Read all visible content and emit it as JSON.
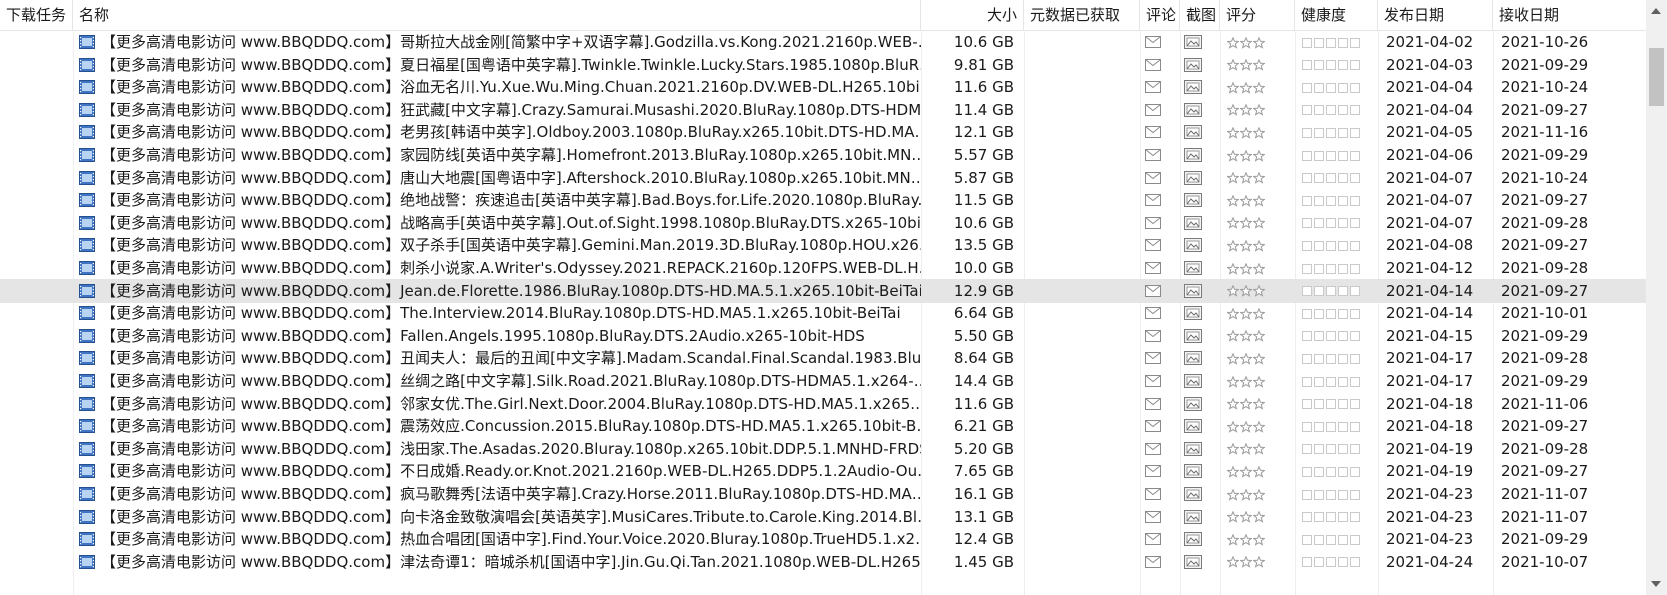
{
  "columns": {
    "task": "下载任务",
    "name": "名称",
    "size": "大小",
    "metadata": "元数据已获取",
    "comments": "评论",
    "screenshot": "截图",
    "rating": "评分",
    "health": "健康度",
    "published": "发布日期",
    "received": "接收日期"
  },
  "icons": {
    "file": "video-file-icon",
    "comment": "envelope-icon",
    "screenshot": "image-icon",
    "rating": "star-icon",
    "health": "health-square-icon"
  },
  "colors": {
    "selected_row": "#e5e5e5",
    "grid_line": "#eeeeee",
    "star": "#9a9a9a"
  },
  "selected_index": 11,
  "rows": [
    {
      "name": "【更多高清电影访问 www.BBQDDQ.com】哥斯拉大战金刚[简繁中字+双语字幕].Godzilla.vs.Kong.2021.2160p.WEB-…",
      "size": "10.6 GB",
      "published": "2021-04-02",
      "received": "2021-10-26"
    },
    {
      "name": "【更多高清电影访问 www.BBQDDQ.com】夏日福星[国粤语中英字幕].Twinkle.Twinkle.Lucky.Stars.1985.1080p.BluR…",
      "size": "9.81 GB",
      "published": "2021-04-03",
      "received": "2021-09-29"
    },
    {
      "name": "【更多高清电影访问 www.BBQDDQ.com】浴血无名川.Yu.Xue.Wu.Ming.Chuan.2021.2160p.DV.WEB-DL.H265.10bi…",
      "size": "11.6 GB",
      "published": "2021-04-04",
      "received": "2021-10-24"
    },
    {
      "name": "【更多高清电影访问 www.BBQDDQ.com】狂武藏[中文字幕].Crazy.Samurai.Musashi.2020.BluRay.1080p.DTS-HDM…",
      "size": "11.4 GB",
      "published": "2021-04-04",
      "received": "2021-09-27"
    },
    {
      "name": "【更多高清电影访问 www.BBQDDQ.com】老男孩[韩语中英字].Oldboy.2003.1080p.BluRay.x265.10bit.DTS-HD.MA…",
      "size": "12.1 GB",
      "published": "2021-04-05",
      "received": "2021-11-16"
    },
    {
      "name": "【更多高清电影访问 www.BBQDDQ.com】家园防线[英语中英字幕].Homefront.2013.BluRay.1080p.x265.10bit.MN…",
      "size": "5.57 GB",
      "published": "2021-04-06",
      "received": "2021-09-29"
    },
    {
      "name": "【更多高清电影访问 www.BBQDDQ.com】唐山大地震[国粤语中字].Aftershock.2010.BluRay.1080p.x265.10bit.MN…",
      "size": "5.87 GB",
      "published": "2021-04-07",
      "received": "2021-10-24"
    },
    {
      "name": "【更多高清电影访问 www.BBQDDQ.com】绝地战警：疾速追击[英语中英字幕].Bad.Boys.for.Life.2020.1080p.BluRay.…",
      "size": "11.5 GB",
      "published": "2021-04-07",
      "received": "2021-09-27"
    },
    {
      "name": "【更多高清电影访问 www.BBQDDQ.com】战略高手[英语中英字幕].Out.of.Sight.1998.1080p.BluRay.DTS.x265-10bi…",
      "size": "10.6 GB",
      "published": "2021-04-07",
      "received": "2021-09-28"
    },
    {
      "name": "【更多高清电影访问 www.BBQDDQ.com】双子杀手[国英语中英字幕].Gemini.Man.2019.3D.BluRay.1080p.HOU.x26…",
      "size": "13.5 GB",
      "published": "2021-04-08",
      "received": "2021-09-27"
    },
    {
      "name": "【更多高清电影访问 www.BBQDDQ.com】刺杀小说家.A.Writer's.Odyssey.2021.REPACK.2160p.120FPS.WEB-DL.H…",
      "size": "10.0 GB",
      "published": "2021-04-12",
      "received": "2021-09-28"
    },
    {
      "name": "【更多高清电影访问 www.BBQDDQ.com】Jean.de.Florette.1986.BluRay.1080p.DTS-HD.MA.5.1.x265.10bit-BeiTai",
      "size": "12.9 GB",
      "published": "2021-04-14",
      "received": "2021-09-27"
    },
    {
      "name": "【更多高清电影访问 www.BBQDDQ.com】The.Interview.2014.BluRay.1080p.DTS-HD.MA5.1.x265.10bit-BeiTai",
      "size": "6.64 GB",
      "published": "2021-04-14",
      "received": "2021-10-01"
    },
    {
      "name": "【更多高清电影访问 www.BBQDDQ.com】Fallen.Angels.1995.1080p.BluRay.DTS.2Audio.x265-10bit-HDS",
      "size": "5.50 GB",
      "published": "2021-04-15",
      "received": "2021-09-29"
    },
    {
      "name": "【更多高清电影访问 www.BBQDDQ.com】丑闻夫人：最后的丑闻[中文字幕].Madam.Scandal.Final.Scandal.1983.Blu…",
      "size": "8.64 GB",
      "published": "2021-04-17",
      "received": "2021-09-28"
    },
    {
      "name": "【更多高清电影访问 www.BBQDDQ.com】丝绸之路[中文字幕].Silk.Road.2021.BluRay.1080p.DTS-HDMA5.1.x264-…",
      "size": "14.4 GB",
      "published": "2021-04-17",
      "received": "2021-09-29"
    },
    {
      "name": "【更多高清电影访问 www.BBQDDQ.com】邻家女优.The.Girl.Next.Door.2004.BluRay.1080p.DTS-HD.MA5.1.x265.…",
      "size": "11.6 GB",
      "published": "2021-04-18",
      "received": "2021-11-06"
    },
    {
      "name": "【更多高清电影访问 www.BBQDDQ.com】震荡效应.Concussion.2015.BluRay.1080p.DTS-HD.MA5.1.x265.10bit-B…",
      "size": "6.21 GB",
      "published": "2021-04-18",
      "received": "2021-09-27"
    },
    {
      "name": "【更多高清电影访问 www.BBQDDQ.com】浅田家.The.Asadas.2020.Bluray.1080p.x265.10bit.DDP.5.1.MNHD-FRDS",
      "size": "5.20 GB",
      "published": "2021-04-19",
      "received": "2021-09-28"
    },
    {
      "name": "【更多高清电影访问 www.BBQDDQ.com】不日成婚.Ready.or.Knot.2021.2160p.WEB-DL.H265.DDP5.1.2Audio-Ou…",
      "size": "7.65 GB",
      "published": "2021-04-19",
      "received": "2021-09-27"
    },
    {
      "name": "【更多高清电影访问 www.BBQDDQ.com】疯马歌舞秀[法语中英字幕].Crazy.Horse.2011.BluRay.1080p.DTS-HD.MA…",
      "size": "16.1 GB",
      "published": "2021-04-23",
      "received": "2021-11-07"
    },
    {
      "name": "【更多高清电影访问 www.BBQDDQ.com】向卡洛金致敬演唱会[英语英字].MusiCares.Tribute.to.Carole.King.2014.Bl…",
      "size": "13.1 GB",
      "published": "2021-04-23",
      "received": "2021-11-07"
    },
    {
      "name": "【更多高清电影访问 www.BBQDDQ.com】热血合唱团[国语中字].Find.Your.Voice.2020.Bluray.1080p.TrueHD5.1.x2…",
      "size": "12.4 GB",
      "published": "2021-04-23",
      "received": "2021-09-29"
    },
    {
      "name": "【更多高清电影访问 www.BBQDDQ.com】津法奇谭1：暗城杀机[国语中字].Jin.Gu.Qi.Tan.2021.1080p.WEB-DL.H265…",
      "size": "1.45 GB",
      "published": "2021-04-24",
      "received": "2021-10-07"
    }
  ]
}
